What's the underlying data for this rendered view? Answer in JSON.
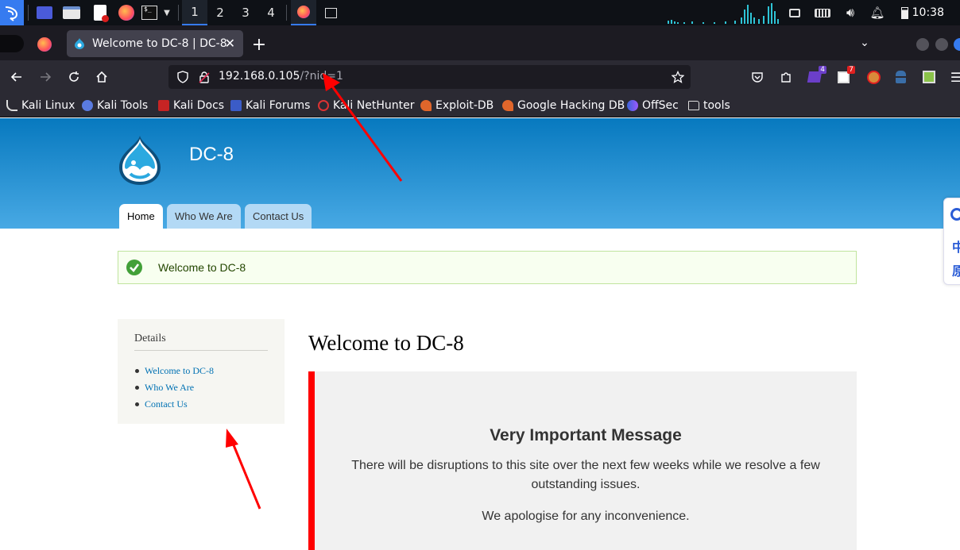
{
  "taskbar": {
    "workspaces": [
      "1",
      "2",
      "3",
      "4"
    ],
    "active_workspace": "1",
    "clock": "10:38",
    "icons": [
      "kali-menu-icon",
      "desktop-icon",
      "file-manager-icon",
      "text-editor-icon",
      "firefox-icon",
      "terminal-icon"
    ]
  },
  "browser": {
    "tab_title": "Welcome to DC-8 | DC-8",
    "url_host": "192.168.0.105",
    "url_query": "/?nid=1",
    "extension_badges": {
      "ext1": "4",
      "ext2": "7"
    }
  },
  "bookmarks": [
    {
      "label": "Kali Linux",
      "icon": "kali-dragon-icon"
    },
    {
      "label": "Kali Tools",
      "icon": "kali-tools-icon"
    },
    {
      "label": "Kali Docs",
      "icon": "kali-docs-icon"
    },
    {
      "label": "Kali Forums",
      "icon": "kali-forums-icon"
    },
    {
      "label": "Kali NetHunter",
      "icon": "nethunter-icon"
    },
    {
      "label": "Exploit-DB",
      "icon": "exploit-db-icon"
    },
    {
      "label": "Google Hacking DB",
      "icon": "ghdb-icon"
    },
    {
      "label": "OffSec",
      "icon": "offsec-icon"
    },
    {
      "label": "tools",
      "icon": "folder-icon"
    }
  ],
  "site": {
    "name": "DC-8",
    "tabs": [
      {
        "label": "Home",
        "active": true
      },
      {
        "label": "Who We Are",
        "active": false
      },
      {
        "label": "Contact Us",
        "active": false
      }
    ],
    "status_message": "Welcome to DC-8",
    "sidebar": {
      "title": "Details",
      "links": [
        "Welcome to DC-8",
        "Who We Are",
        "Contact Us"
      ]
    },
    "page_title": "Welcome to DC-8",
    "important": {
      "heading": "Very Important Message",
      "body": "There will be disruptions to this site over the next few weeks while we resolve a few outstanding issues.",
      "apology": "We apologise for any inconvenience."
    }
  },
  "side_widget": {
    "chars": [
      "中",
      "原"
    ]
  },
  "colors": {
    "header_top": "#0779bf",
    "header_bottom": "#48a9e4",
    "alert_border": "#ff0000",
    "link": "#0071b3",
    "annotation_arrow": "#ff0000"
  }
}
